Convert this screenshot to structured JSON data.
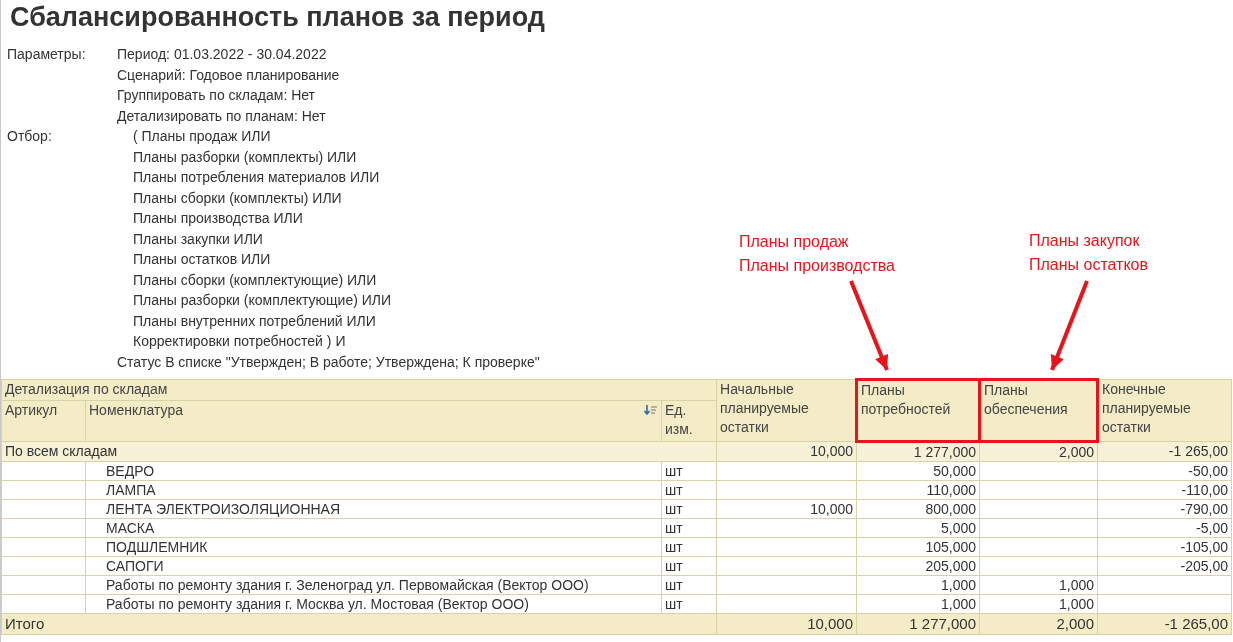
{
  "title": "Сбалансированность планов за период",
  "parameters": {
    "label": "Параметры:",
    "lines": [
      "Период: 01.03.2022 - 30.04.2022",
      "Сценарий: Годовое планирование",
      "Группировать по складам: Нет",
      "Детализировать по планам: Нет"
    ]
  },
  "filter": {
    "label": "Отбор:",
    "lines": [
      "( Планы продаж ИЛИ",
      "Планы разборки (комплекты) ИЛИ",
      "Планы потребления материалов ИЛИ",
      "Планы сборки (комплекты) ИЛИ",
      "Планы производства ИЛИ",
      "Планы закупки ИЛИ",
      "Планы остатков ИЛИ",
      "Планы сборки (комплектующие) ИЛИ",
      "Планы разборки (комплектующие) ИЛИ",
      "Планы внутренних потреблений ИЛИ",
      "Корректировки потребностей ) И"
    ],
    "status": "Статус В списке \"Утвержден; В работе; Утверждена; К проверке\""
  },
  "annotations": [
    {
      "lines": [
        "Планы продаж",
        "Планы производства"
      ]
    },
    {
      "lines": [
        "Планы закупок",
        "Планы остатков"
      ]
    }
  ],
  "table": {
    "group_header": "Детализация по складам",
    "columns": [
      {
        "label": "Артикул",
        "sorted": false
      },
      {
        "label": "Номенклатура",
        "sorted": true
      },
      {
        "label": "Ед. изм.",
        "sorted": false
      }
    ],
    "value_columns": [
      {
        "label": "Начальные планируемые остатки",
        "highlighted": false
      },
      {
        "label": "Планы потребностей",
        "highlighted": true
      },
      {
        "label": "Планы обеспечения",
        "highlighted": true
      },
      {
        "label": "Конечные планируемые остатки",
        "highlighted": false
      }
    ],
    "group_row": {
      "label": "По всем складам",
      "values": {
        "initial": "10,000",
        "demand": "1 277,000",
        "supply": "2,000",
        "final": "-1 265,00"
      }
    },
    "rows": [
      {
        "name": "ВЕДРО",
        "unit": "шт",
        "values": {
          "demand": "50,000",
          "final": "-50,00"
        }
      },
      {
        "name": "ЛАМПА",
        "unit": "шт",
        "values": {
          "demand": "110,000",
          "final": "-110,00"
        }
      },
      {
        "name": "ЛЕНТА ЭЛЕКТРОИЗОЛЯЦИОННАЯ",
        "unit": "шт",
        "values": {
          "initial": "10,000",
          "demand": "800,000",
          "final": "-790,00"
        }
      },
      {
        "name": "МАСКА",
        "unit": "шт",
        "values": {
          "demand": "5,000",
          "final": "-5,00"
        }
      },
      {
        "name": "ПОДШЛЕМНИК",
        "unit": "шт",
        "values": {
          "demand": "105,000",
          "final": "-105,00"
        }
      },
      {
        "name": "САПОГИ",
        "unit": "шт",
        "values": {
          "demand": "205,000",
          "final": "-205,00"
        }
      },
      {
        "name": "Работы по ремонту здания г. Зеленоград ул. Первомайская (Вектор ООО)",
        "unit": "шт",
        "values": {
          "demand": "1,000",
          "supply": "1,000"
        }
      },
      {
        "name": "Работы по ремонту здания г. Москва ул. Мостовая (Вектор ООО)",
        "unit": "шт",
        "values": {
          "demand": "1,000",
          "supply": "1,000"
        }
      }
    ],
    "total": {
      "label": "Итого",
      "values": {
        "initial": "10,000",
        "demand": "1 277,000",
        "supply": "2,000",
        "final": "-1 265,00"
      }
    }
  }
}
